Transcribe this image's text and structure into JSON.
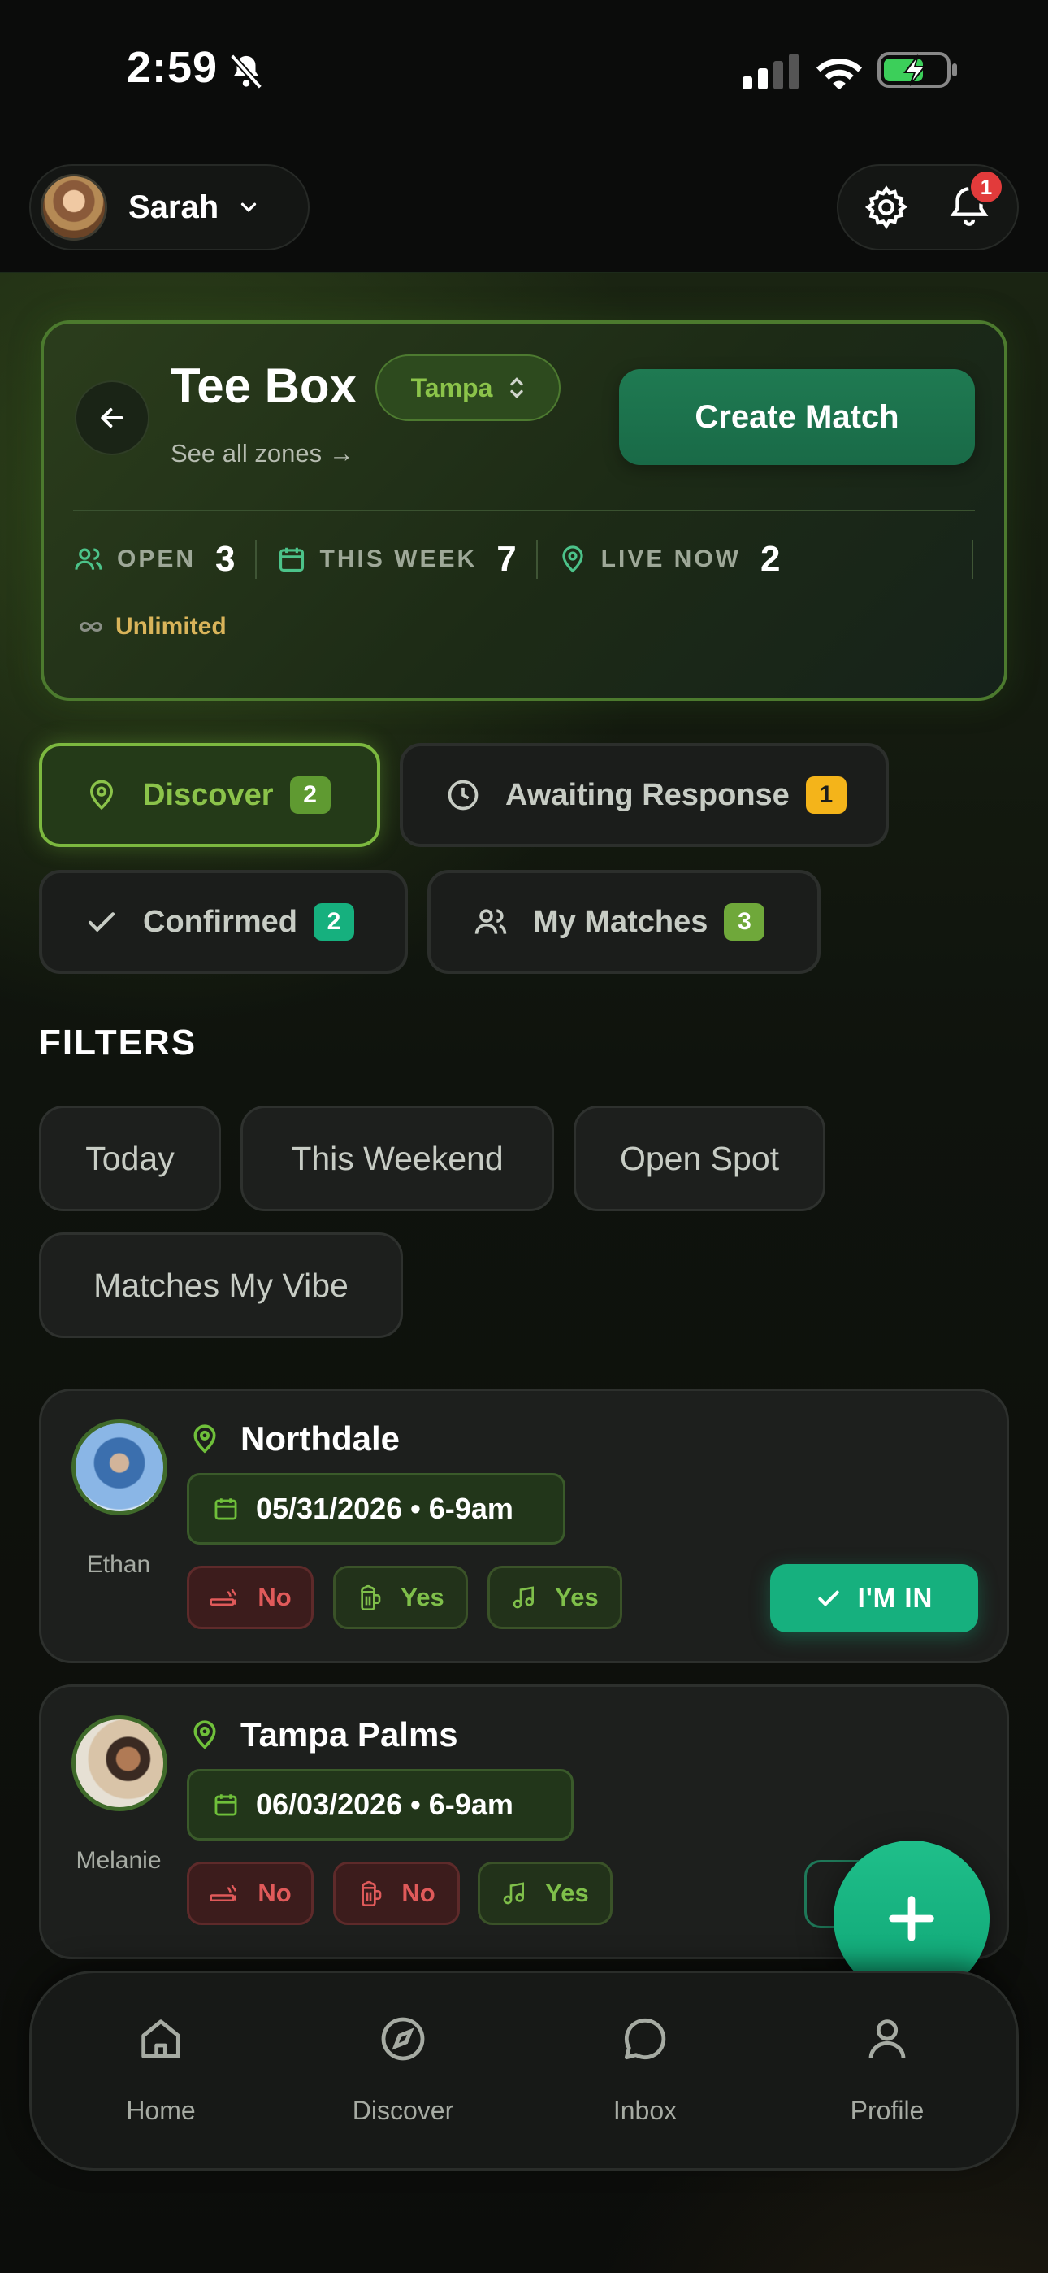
{
  "status_bar": {
    "time": "2:59"
  },
  "header": {
    "user_name": "Sarah",
    "notification_count": "1"
  },
  "zone": {
    "title": "Tee Box",
    "city": "Tampa",
    "see_all": "See all zones →",
    "create_button": "Create Match",
    "stats": [
      {
        "label": "OPEN",
        "value": "3"
      },
      {
        "label": "THIS WEEK",
        "value": "7"
      },
      {
        "label": "LIVE NOW",
        "value": "2"
      }
    ],
    "plan": "Unlimited"
  },
  "tabs": [
    {
      "label": "Discover",
      "count": "2",
      "active": true,
      "badge_color": "#5f9a31"
    },
    {
      "label": "Awaiting Response",
      "count": "1",
      "active": false,
      "badge_color": "#f4b41a"
    },
    {
      "label": "Confirmed",
      "count": "2",
      "active": false,
      "badge_color": "#16b07e"
    },
    {
      "label": "My Matches",
      "count": "3",
      "active": false,
      "badge_color": "#6fa83a"
    }
  ],
  "filters": {
    "heading": "FILTERS",
    "chips": [
      "Today",
      "This Weekend",
      "Open Spot",
      "Matches My Vibe"
    ]
  },
  "matches": [
    {
      "host": "Ethan",
      "location": "Northdale",
      "date": "05/31/2026 • 6-9am",
      "smoking": "No",
      "drinking": "Yes",
      "music": "Yes",
      "action": "I'M IN"
    },
    {
      "host": "Melanie",
      "location": "Tampa Palms",
      "date": "06/03/2026 • 6-9am",
      "smoking": "No",
      "drinking": "No",
      "music": "Yes"
    }
  ],
  "nav": [
    {
      "label": "Home",
      "icon": "home-icon"
    },
    {
      "label": "Discover",
      "icon": "compass-icon"
    },
    {
      "label": "Inbox",
      "icon": "chat-icon"
    },
    {
      "label": "Profile",
      "icon": "person-icon"
    }
  ],
  "colors": {
    "accent_green": "#8bc34a",
    "action_teal": "#16b07e",
    "no_red": "#e05a5a",
    "gold": "#d9b45a"
  }
}
